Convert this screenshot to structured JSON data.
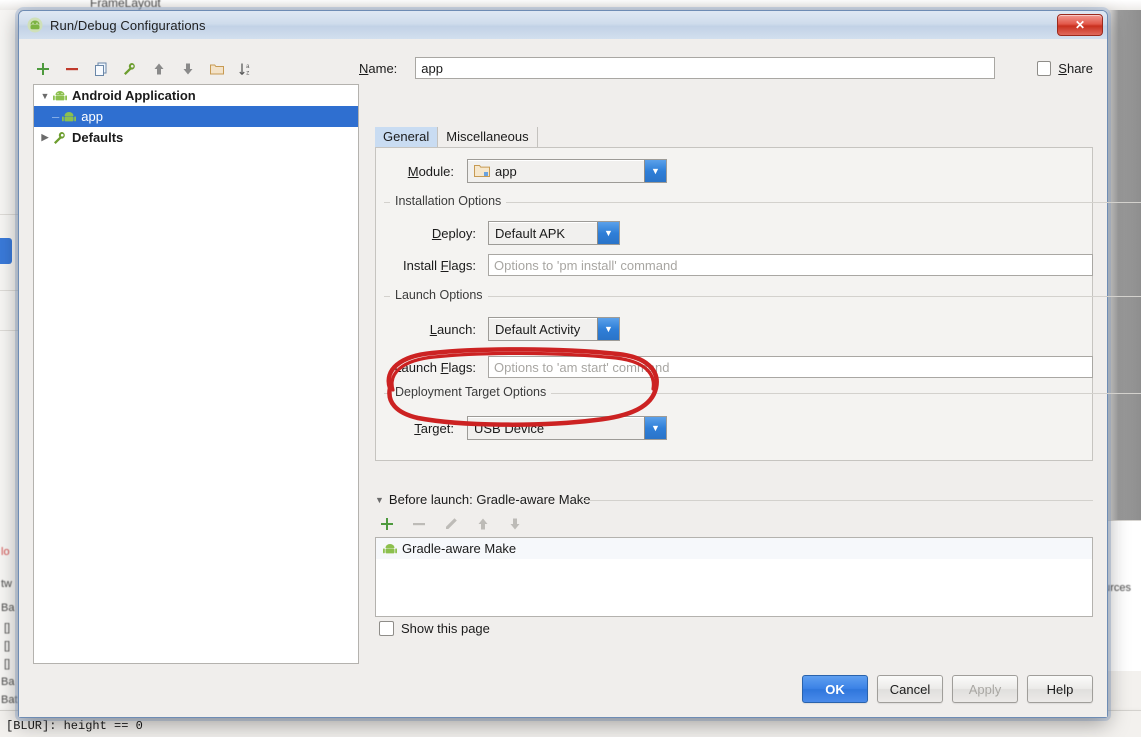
{
  "window": {
    "title": "Run/Debug Configurations",
    "icon": "android-icon",
    "close_label": "✕"
  },
  "tree": {
    "toolbar": [
      {
        "name": "add-configuration-button",
        "glyph": "+"
      },
      {
        "name": "remove-configuration-button",
        "glyph": "−"
      },
      {
        "name": "copy-configuration-button",
        "glyph": "copy-icon"
      },
      {
        "name": "edit-defaults-button",
        "glyph": "wrench-icon"
      },
      {
        "name": "move-up-button",
        "glyph": "↑"
      },
      {
        "name": "move-down-button",
        "glyph": "↓"
      },
      {
        "name": "create-folder-button",
        "glyph": "folder-icon"
      },
      {
        "name": "sort-button",
        "glyph": "sort-az-icon"
      }
    ],
    "items": [
      {
        "label": "Android Application",
        "icon": "android-icon",
        "expanded": true,
        "bold": true,
        "selected": false,
        "child": false
      },
      {
        "label": "app",
        "icon": "android-icon",
        "expanded": false,
        "bold": false,
        "selected": true,
        "child": true
      },
      {
        "label": "Defaults",
        "icon": "wrench-icon",
        "expanded": false,
        "bold": true,
        "selected": false,
        "child": false
      }
    ]
  },
  "name_row": {
    "label": "Name:",
    "label_mnemonic": "N",
    "value": "app",
    "share_label": "Share",
    "share_mnemonic": "S",
    "share_checked": false
  },
  "tabs": [
    {
      "label": "General",
      "active": true
    },
    {
      "label": "Miscellaneous",
      "active": false
    }
  ],
  "general": {
    "module": {
      "label": "Module:",
      "mnemonic": "M",
      "value": "app",
      "icon": "module-folder-icon"
    },
    "installation_options": {
      "title": "Installation Options",
      "deploy": {
        "label": "Deploy:",
        "mnemonic": "D",
        "value": "Default APK"
      },
      "install_flags": {
        "label": "Install Flags:",
        "mnemonic": "F",
        "value": "",
        "placeholder": "Options to 'pm install' command"
      }
    },
    "launch_options": {
      "title": "Launch Options",
      "launch": {
        "label": "Launch:",
        "mnemonic": "L",
        "value": "Default Activity"
      },
      "launch_flags": {
        "label": "Launch Flags:",
        "mnemonic": "F",
        "value": "",
        "placeholder": "Options to 'am start' command"
      }
    },
    "deployment_target_options": {
      "title": "Deployment Target Options",
      "target": {
        "label": "Target:",
        "mnemonic": "T",
        "value": "USB Device"
      }
    }
  },
  "before_launch": {
    "header": "Before launch: Gradle-aware Make",
    "header_mnemonic": "B",
    "expanded": true,
    "toolbar": [
      {
        "name": "add-task-button",
        "glyph": "+",
        "enabled": true
      },
      {
        "name": "remove-task-button",
        "glyph": "−",
        "enabled": false
      },
      {
        "name": "edit-task-button",
        "glyph": "pencil-icon",
        "enabled": false
      },
      {
        "name": "task-move-up-button",
        "glyph": "↑",
        "enabled": false
      },
      {
        "name": "task-move-down-button",
        "glyph": "↓",
        "enabled": false
      }
    ],
    "tasks": [
      {
        "label": "Gradle-aware Make",
        "icon": "android-icon"
      }
    ],
    "show_this_page": {
      "label": "Show this page",
      "checked": false
    }
  },
  "buttons": [
    {
      "label": "OK",
      "style": "primary",
      "enabled": true
    },
    {
      "label": "Cancel",
      "style": "normal",
      "enabled": true
    },
    {
      "label": "Apply",
      "style": "normal",
      "enabled": false
    },
    {
      "label": "Help",
      "style": "normal",
      "enabled": true
    }
  ],
  "annotation": {
    "shape": "hand-drawn-ellipse",
    "color": "#cc2222",
    "targets": "Deployment Target Options / Target: USB Device"
  },
  "background": {
    "top_fragment": "FrameLayout",
    "right_fragment": "ources",
    "status_text": "[BLUR]: height == 0",
    "left_fragments": [
      "lo",
      "tw",
      "Ba",
      "[]",
      "[]",
      "[]",
      "Ba",
      "Bat"
    ]
  },
  "colors": {
    "selection_blue": "#2f6fd0",
    "combo_arrow_blue": "#2f7fd8",
    "primary_button": "#3b82e6",
    "annotation_red": "#cc2222",
    "close_red": "#c9301f"
  }
}
